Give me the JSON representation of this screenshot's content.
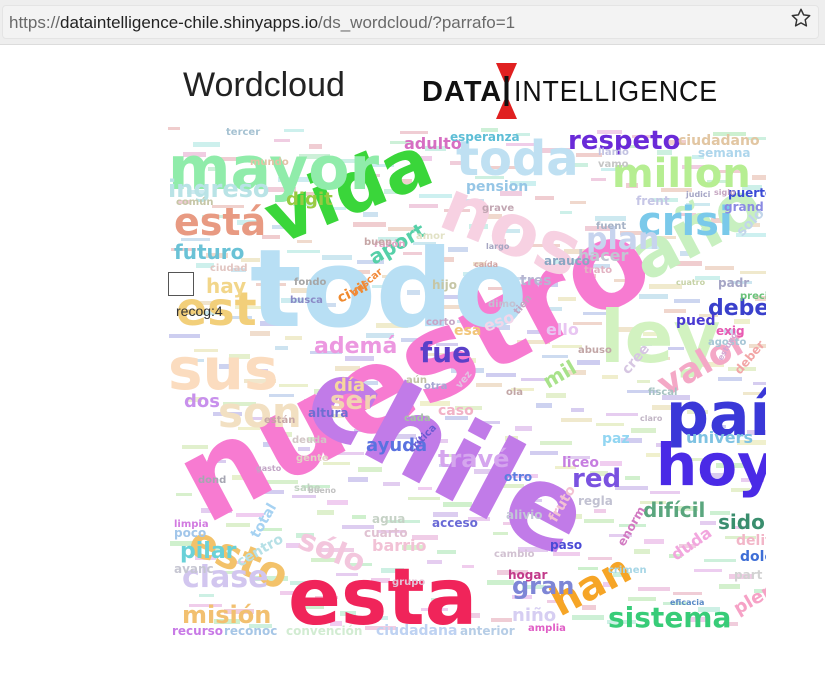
{
  "browser": {
    "url_prefix": "https://",
    "url_host": "dataintelligence-chile.shinyapps.io",
    "url_path": "/ds_wordcloud/?parrafo=1",
    "star_icon": "star-outline-icon"
  },
  "header": {
    "title": "Wordcloud",
    "logo_left": "DATA",
    "logo_right": "INTELLIGENCE",
    "logo_accent_color": "#e02020"
  },
  "tooltip": {
    "label": "recog:4"
  },
  "cloud": {
    "words": [
      {
        "text": "nuestro",
        "color": "#f77bd1"
      },
      {
        "text": "chile",
        "color": "#c17be8"
      },
      {
        "text": "todo",
        "color": "#b8dff4"
      },
      {
        "text": "esta",
        "color": "#f0245a"
      },
      {
        "text": "vida",
        "color": "#3ad63a"
      },
      {
        "text": "nos",
        "color": "#f7d1e2"
      },
      {
        "text": "ley",
        "color": "#d2f2c0"
      },
      {
        "text": "año",
        "color": "#c8f0c0"
      },
      {
        "text": "mayor",
        "color": "#90ecaa"
      },
      {
        "text": "sus",
        "color": "#fbdcbf"
      },
      {
        "text": "hoy",
        "color": "#4a2ae6"
      },
      {
        "text": "paí",
        "color": "#3a38d8"
      },
      {
        "text": "esto",
        "color": "#f3c26a"
      },
      {
        "text": "toda",
        "color": "#bfe0f2"
      },
      {
        "text": "millon",
        "color": "#b6ee92"
      },
      {
        "text": "crisi",
        "color": "#7ac9ea"
      },
      {
        "text": "está",
        "color": "#e89a82"
      },
      {
        "text": "ingreso",
        "color": "#b9e3e6"
      },
      {
        "text": "est",
        "color": "#f2cf7a"
      },
      {
        "text": "son",
        "color": "#f2e0c2"
      },
      {
        "text": "han",
        "color": "#f6a526"
      },
      {
        "text": "sistema",
        "color": "#38cc78"
      },
      {
        "text": "valor",
        "color": "#f4a8c6"
      },
      {
        "text": "clase",
        "color": "#d2c6ef"
      },
      {
        "text": "respeto",
        "color": "#6a2ad8"
      },
      {
        "text": "plan",
        "color": "#c7d4ee"
      },
      {
        "text": "fue",
        "color": "#5a40c8"
      },
      {
        "text": "sólo",
        "color": "#f3c6dd"
      },
      {
        "text": "misión",
        "color": "#f2c070"
      },
      {
        "text": "debe",
        "color": "#3a40cc"
      },
      {
        "text": "travé",
        "color": "#d5a6ee"
      },
      {
        "text": "red",
        "color": "#7a52e0"
      },
      {
        "text": "futuro",
        "color": "#6ac2d6"
      },
      {
        "text": "pilar",
        "color": "#6ad1d8"
      },
      {
        "text": "sido",
        "color": "#3a8e6e"
      },
      {
        "text": "difícil",
        "color": "#5aa67e"
      },
      {
        "text": "gran",
        "color": "#7e86d6"
      },
      {
        "text": "dos",
        "color": "#c890ec"
      },
      {
        "text": "ser",
        "color": "#f2d2b2"
      },
      {
        "text": "ayuda",
        "color": "#5a72e0"
      },
      {
        "text": "ademá",
        "color": "#ec98e0"
      },
      {
        "text": "aport",
        "color": "#56d0a8"
      },
      {
        "text": "digit",
        "color": "#98ca42"
      },
      {
        "text": "pension",
        "color": "#96c6e6"
      },
      {
        "text": "ciudadano",
        "color": "#e2c6a2"
      },
      {
        "text": "adulto",
        "color": "#d66ec2"
      },
      {
        "text": "esperanza",
        "color": "#5ebed6"
      },
      {
        "text": "semana",
        "color": "#aed6ec"
      },
      {
        "text": "hacer",
        "color": "#c2c6d2"
      },
      {
        "text": "tres",
        "color": "#b6b6d2"
      },
      {
        "text": "civil",
        "color": "#f08a2e"
      },
      {
        "text": "hay",
        "color": "#f2d68a"
      },
      {
        "text": "día",
        "color": "#f6d69e"
      },
      {
        "text": "mil",
        "color": "#a8e28a"
      },
      {
        "text": "univers",
        "color": "#7ec2e2"
      },
      {
        "text": "liceo",
        "color": "#c67ee0"
      },
      {
        "text": "delito",
        "color": "#f2b6c8"
      },
      {
        "text": "dolor",
        "color": "#3e6ed6"
      },
      {
        "text": "plena",
        "color": "#f6a2c6"
      },
      {
        "text": "niño",
        "color": "#d6cef2"
      },
      {
        "text": "recurso",
        "color": "#c87ae6"
      },
      {
        "text": "reconoc",
        "color": "#a6c6e6"
      },
      {
        "text": "convención",
        "color": "#d2ecd2"
      },
      {
        "text": "ciudadana",
        "color": "#bed2f2"
      },
      {
        "text": "anterior",
        "color": "#b6cde6"
      },
      {
        "text": "amplia",
        "color": "#e05ec6"
      },
      {
        "text": "puerto",
        "color": "#3a4ad6"
      },
      {
        "text": "grand",
        "color": "#8a8ae2"
      },
      {
        "text": "solo",
        "color": "#c2d6ea"
      },
      {
        "text": "precio",
        "color": "#6ac27a"
      },
      {
        "text": "exig",
        "color": "#e85ab2"
      },
      {
        "text": "duda",
        "color": "#f2a6de"
      },
      {
        "text": "paz",
        "color": "#92d6f2"
      },
      {
        "text": "ello",
        "color": "#e8c6f2"
      },
      {
        "text": "eso",
        "color": "#f2d6ea"
      },
      {
        "text": "esa",
        "color": "#f2c67a"
      },
      {
        "text": "caso",
        "color": "#f2b2c6"
      },
      {
        "text": "total",
        "color": "#a6d2f2"
      },
      {
        "text": "acceso",
        "color": "#6a6ad6"
      },
      {
        "text": "alivio",
        "color": "#c2c6d6"
      },
      {
        "text": "otro",
        "color": "#5a7ee0"
      },
      {
        "text": "barrio",
        "color": "#f2c2d6"
      },
      {
        "text": "cuarto",
        "color": "#e0c2d2"
      },
      {
        "text": "agua",
        "color": "#c6d2c6"
      },
      {
        "text": "paso",
        "color": "#4a4ad6"
      },
      {
        "text": "hogar",
        "color": "#c23a8a"
      },
      {
        "text": "regla",
        "color": "#c2c2d2"
      },
      {
        "text": "part",
        "color": "#d2d2d2"
      },
      {
        "text": "fruto",
        "color": "#f2c2d2"
      },
      {
        "text": "crimen",
        "color": "#a6d6e6"
      },
      {
        "text": "enorm",
        "color": "#d27ac2"
      },
      {
        "text": "cambio",
        "color": "#d2c2d2"
      },
      {
        "text": "centro",
        "color": "#b6e0e6"
      },
      {
        "text": "avanc",
        "color": "#c6c6d2"
      },
      {
        "text": "poco",
        "color": "#a2c6ea"
      },
      {
        "text": "limpia",
        "color": "#d27ae0"
      },
      {
        "text": "grupo",
        "color": "#e2c2d6"
      },
      {
        "text": "razón",
        "color": "#e2a6c6"
      },
      {
        "text": "deuda",
        "color": "#d2c6c6"
      },
      {
        "text": "sabe",
        "color": "#c2d2c2"
      },
      {
        "text": "altura",
        "color": "#6e6ed2"
      },
      {
        "text": "gente",
        "color": "#e2d2c6"
      },
      {
        "text": "pued",
        "color": "#4a3ad2"
      },
      {
        "text": "padr",
        "color": "#a6a6c6"
      },
      {
        "text": "agosto",
        "color": "#a6c6d6"
      },
      {
        "text": "cree",
        "color": "#d6c6e2"
      },
      {
        "text": "deber",
        "color": "#f2a6a6"
      },
      {
        "text": "trato",
        "color": "#e2b2c2"
      },
      {
        "text": "arauco",
        "color": "#8aa6c2"
      },
      {
        "text": "buen",
        "color": "#c6a6a6"
      },
      {
        "text": "amor",
        "color": "#e2e2c6"
      },
      {
        "text": "fuent",
        "color": "#a6b2c6"
      },
      {
        "text": "frent",
        "color": "#c6c6e6"
      },
      {
        "text": "buscar",
        "color": "#f28a3a"
      },
      {
        "text": "hijo",
        "color": "#c6c6a6"
      },
      {
        "text": "corto",
        "color": "#c6a6c6"
      },
      {
        "text": "ciudad",
        "color": "#e2c6c2"
      },
      {
        "text": "fondo",
        "color": "#a6a6a6"
      },
      {
        "text": "busca",
        "color": "#8a8ac6"
      },
      {
        "text": "grave",
        "color": "#c2a6b2"
      },
      {
        "text": "vamo",
        "color": "#c6c6c6"
      },
      {
        "text": "llamo",
        "color": "#c2c2e2"
      },
      {
        "text": "tercer",
        "color": "#a6c2d2"
      },
      {
        "text": "común",
        "color": "#c6c6a6"
      },
      {
        "text": "mundo",
        "color": "#e2c2a6"
      },
      {
        "text": "están",
        "color": "#c6a6a6"
      },
      {
        "text": "cada",
        "color": "#a6c2a6"
      },
      {
        "text": "otra",
        "color": "#a6a6d2"
      },
      {
        "text": "tien",
        "color": "#c2a6c2"
      },
      {
        "text": "aún",
        "color": "#c2c2a6"
      },
      {
        "text": "vez",
        "color": "#e2c2e2"
      },
      {
        "text": "ola",
        "color": "#c2a6a6"
      },
      {
        "text": "dond",
        "color": "#a6a6b2"
      },
      {
        "text": "eficacia",
        "color": "#5a8ac6"
      },
      {
        "text": "gasto",
        "color": "#c2a6c6"
      },
      {
        "text": "largo",
        "color": "#a6a6c2"
      },
      {
        "text": "cuatro",
        "color": "#c6d2a6"
      },
      {
        "text": "claro",
        "color": "#c2b6c6"
      },
      {
        "text": "fiscal",
        "color": "#a6c2c2"
      },
      {
        "text": "estuvo",
        "color": "#d2a6d2"
      },
      {
        "text": "dimo",
        "color": "#c2c2d2"
      },
      {
        "text": "crítica",
        "color": "#6a5ad2"
      },
      {
        "text": "abuso",
        "color": "#c2a6a6"
      },
      {
        "text": "bueno",
        "color": "#c2c2c2"
      },
      {
        "text": "siglo",
        "color": "#c6a6c2"
      },
      {
        "text": "judici",
        "color": "#a6a6c6"
      },
      {
        "text": "caída",
        "color": "#d2a6a6"
      }
    ]
  }
}
